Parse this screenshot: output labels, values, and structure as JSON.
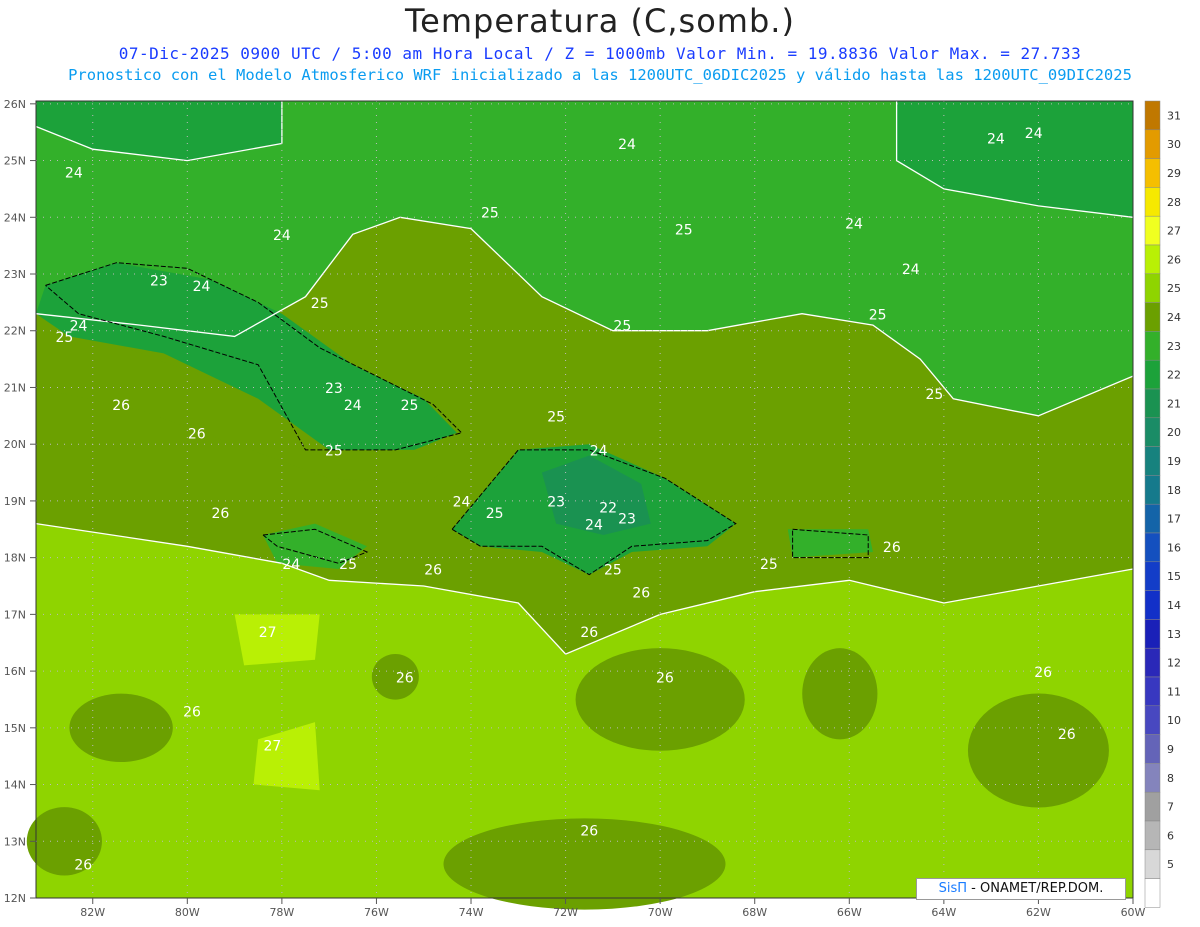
{
  "header": {
    "title": "Temperatura (C,somb.)",
    "line1": "07-Dic-2025  0900 UTC / 5:00 am Hora Local / Z = 1000mb   Valor Min. = 19.8836  Valor Max. = 27.733",
    "line2": "Pronostico con el Modelo Atmosferico WRF inicializado a las 1200UTC_06DIC2025 y válido hasta las  1200UTC_09DIC2025"
  },
  "map": {
    "lat_labels": [
      "26N",
      "25N",
      "24N",
      "23N",
      "22N",
      "21N",
      "20N",
      "19N",
      "18N",
      "17N",
      "16N",
      "15N",
      "14N",
      "13N",
      "12N"
    ],
    "lon_labels": [
      "82W",
      "80W",
      "78W",
      "76W",
      "74W",
      "72W",
      "70W",
      "68W",
      "66W",
      "64W",
      "62W",
      "60W"
    ],
    "contour_labels": [
      {
        "text": "24",
        "lon": -82.4,
        "lat": 24.7
      },
      {
        "text": "24",
        "lon": -78.0,
        "lat": 23.6
      },
      {
        "text": "24",
        "lon": -70.7,
        "lat": 25.2
      },
      {
        "text": "24",
        "lon": -65.9,
        "lat": 23.8
      },
      {
        "text": "24",
        "lon": -64.7,
        "lat": 23.0
      },
      {
        "text": "24",
        "lon": -62.9,
        "lat": 25.3
      },
      {
        "text": "24",
        "lon": -62.1,
        "lat": 25.4
      },
      {
        "text": "25",
        "lon": -73.6,
        "lat": 24.0
      },
      {
        "text": "25",
        "lon": -69.5,
        "lat": 23.7
      },
      {
        "text": "25",
        "lon": -77.2,
        "lat": 22.4
      },
      {
        "text": "25",
        "lon": -70.8,
        "lat": 22.0
      },
      {
        "text": "25",
        "lon": -65.4,
        "lat": 22.2
      },
      {
        "text": "23",
        "lon": -80.6,
        "lat": 22.8
      },
      {
        "text": "24",
        "lon": -79.7,
        "lat": 22.7
      },
      {
        "text": "24",
        "lon": -82.3,
        "lat": 22.0
      },
      {
        "text": "25",
        "lon": -82.6,
        "lat": 21.8
      },
      {
        "text": "23",
        "lon": -76.9,
        "lat": 20.9
      },
      {
        "text": "24",
        "lon": -76.5,
        "lat": 20.6
      },
      {
        "text": "25",
        "lon": -75.3,
        "lat": 20.6
      },
      {
        "text": "26",
        "lon": -81.4,
        "lat": 20.6
      },
      {
        "text": "26",
        "lon": -79.8,
        "lat": 20.1
      },
      {
        "text": "25",
        "lon": -76.9,
        "lat": 19.8
      },
      {
        "text": "25",
        "lon": -72.2,
        "lat": 20.4
      },
      {
        "text": "24",
        "lon": -71.3,
        "lat": 19.8
      },
      {
        "text": "25",
        "lon": -64.2,
        "lat": 20.8
      },
      {
        "text": "26",
        "lon": -79.3,
        "lat": 18.7
      },
      {
        "text": "24",
        "lon": -74.2,
        "lat": 18.9
      },
      {
        "text": "25",
        "lon": -73.5,
        "lat": 18.7
      },
      {
        "text": "23",
        "lon": -72.2,
        "lat": 18.9
      },
      {
        "text": "22",
        "lon": -71.1,
        "lat": 18.8
      },
      {
        "text": "24",
        "lon": -71.4,
        "lat": 18.5
      },
      {
        "text": "23",
        "lon": -70.7,
        "lat": 18.6
      },
      {
        "text": "24",
        "lon": -77.8,
        "lat": 17.8
      },
      {
        "text": "25",
        "lon": -76.6,
        "lat": 17.8
      },
      {
        "text": "26",
        "lon": -74.8,
        "lat": 17.7
      },
      {
        "text": "25",
        "lon": -71.0,
        "lat": 17.7
      },
      {
        "text": "25",
        "lon": -67.7,
        "lat": 17.8
      },
      {
        "text": "26",
        "lon": -65.1,
        "lat": 18.1
      },
      {
        "text": "26",
        "lon": -70.4,
        "lat": 17.3
      },
      {
        "text": "26",
        "lon": -71.5,
        "lat": 16.6
      },
      {
        "text": "27",
        "lon": -78.3,
        "lat": 16.6
      },
      {
        "text": "26",
        "lon": -75.4,
        "lat": 15.8
      },
      {
        "text": "26",
        "lon": -69.9,
        "lat": 15.8
      },
      {
        "text": "26",
        "lon": -61.9,
        "lat": 15.9
      },
      {
        "text": "26",
        "lon": -79.9,
        "lat": 15.2
      },
      {
        "text": "27",
        "lon": -78.2,
        "lat": 14.6
      },
      {
        "text": "26",
        "lon": -61.4,
        "lat": 14.8
      },
      {
        "text": "26",
        "lon": -71.5,
        "lat": 13.1
      },
      {
        "text": "26",
        "lon": -82.2,
        "lat": 12.5
      }
    ]
  },
  "legend": {
    "ticks": [
      "31",
      "30",
      "29",
      "28",
      "27",
      "26",
      "25",
      "24",
      "23",
      "22",
      "21",
      "20",
      "19",
      "18",
      "17",
      "16",
      "15",
      "14",
      "13",
      "12",
      "11",
      "10",
      "9",
      "8",
      "7",
      "6",
      "5"
    ],
    "colors": [
      "#c07800",
      "#e39b00",
      "#f5bf00",
      "#f6e900",
      "#f0ff20",
      "#b9f005",
      "#8fd400",
      "#6ba000",
      "#33b02a",
      "#1ca23a",
      "#1a9251",
      "#1a8c66",
      "#17827e",
      "#157a8c",
      "#1464a8",
      "#1450bf",
      "#133dc8",
      "#1230c8",
      "#1a20b8",
      "#2a28b8",
      "#3838c0",
      "#4848c0",
      "#6464b8",
      "#8484bc",
      "#a0a0a0",
      "#b6b6b6",
      "#d8d8d8",
      "#ffffff"
    ]
  },
  "credit": {
    "sis": "SisΠ",
    "rest": " - ONAMET/REP.DOM."
  }
}
